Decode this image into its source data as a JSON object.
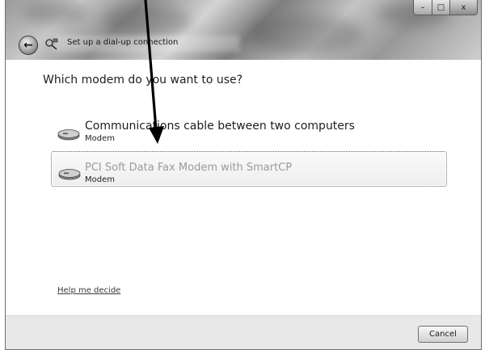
{
  "window": {
    "title": "Set up a dial-up connection",
    "back_icon": "back-arrow-icon",
    "caption": {
      "minimize": "–",
      "maximize": "□",
      "close": "x"
    }
  },
  "main": {
    "question": "Which modem do you want to use?",
    "modems": [
      {
        "name": "Communications cable between two computers",
        "type": "Modem",
        "icon": "modem-icon"
      },
      {
        "name": "PCI Soft Data Fax Modem with SmartCP",
        "type": "Modem",
        "icon": "modem-icon"
      }
    ],
    "help_link": "Help me decide"
  },
  "footer": {
    "cancel_label": "Cancel"
  },
  "colors": {
    "text": "#1e1e1e",
    "selected_item_text": "#9a9a9a",
    "footer_bg": "#e8e8e8",
    "arrow": "#000000"
  }
}
